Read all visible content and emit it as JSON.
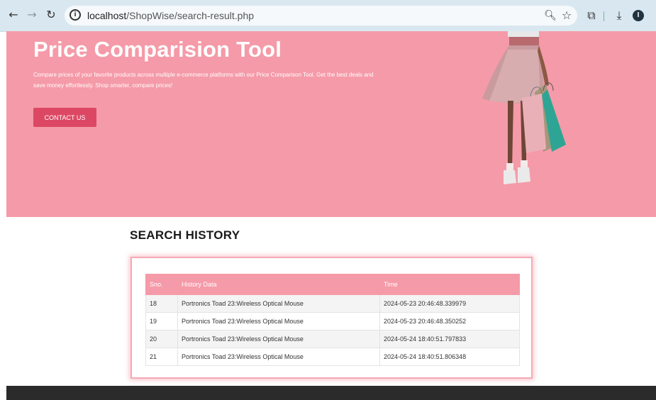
{
  "browser": {
    "url_host": "localhost",
    "url_path": "/ShopWise/search-result.php",
    "profile_initial": "I",
    "icons": {
      "back": "arrow-left-icon",
      "forward": "arrow-right-icon",
      "reload": "reload-icon",
      "site_info": "info-circle-icon",
      "zoom": "zoom-icon",
      "bookmark": "star-icon",
      "extensions": "puzzle-icon",
      "download": "download-icon"
    }
  },
  "hero": {
    "title": "Price Comparision Tool",
    "text": "Compare prices of your favorite products across multiple e-commerce platforms with our Price Comparison Tool. Get the best deals and save money effortlessly. Shop smarter, compare prices!",
    "button_label": "CONTACT US",
    "background_color": "#f59aa8",
    "button_color": "#dc4864"
  },
  "history": {
    "title": "SEARCH HISTORY",
    "columns": [
      "Sno.",
      "History Data",
      "Time"
    ],
    "rows": [
      {
        "sno": "18",
        "data": "Portronics Toad 23:Wireless Optical Mouse",
        "time": "2024-05-23 20:46:48.339979"
      },
      {
        "sno": "19",
        "data": "Portronics Toad 23:Wireless Optical Mouse",
        "time": "2024-05-23 20:46:48.350252"
      },
      {
        "sno": "20",
        "data": "Portronics Toad 23:Wireless Optical Mouse",
        "time": "2024-05-24 18:40:51.797833"
      },
      {
        "sno": "21",
        "data": "Portronics Toad 23:Wireless Optical Mouse",
        "time": "2024-05-24 18:40:51.806348"
      }
    ]
  }
}
